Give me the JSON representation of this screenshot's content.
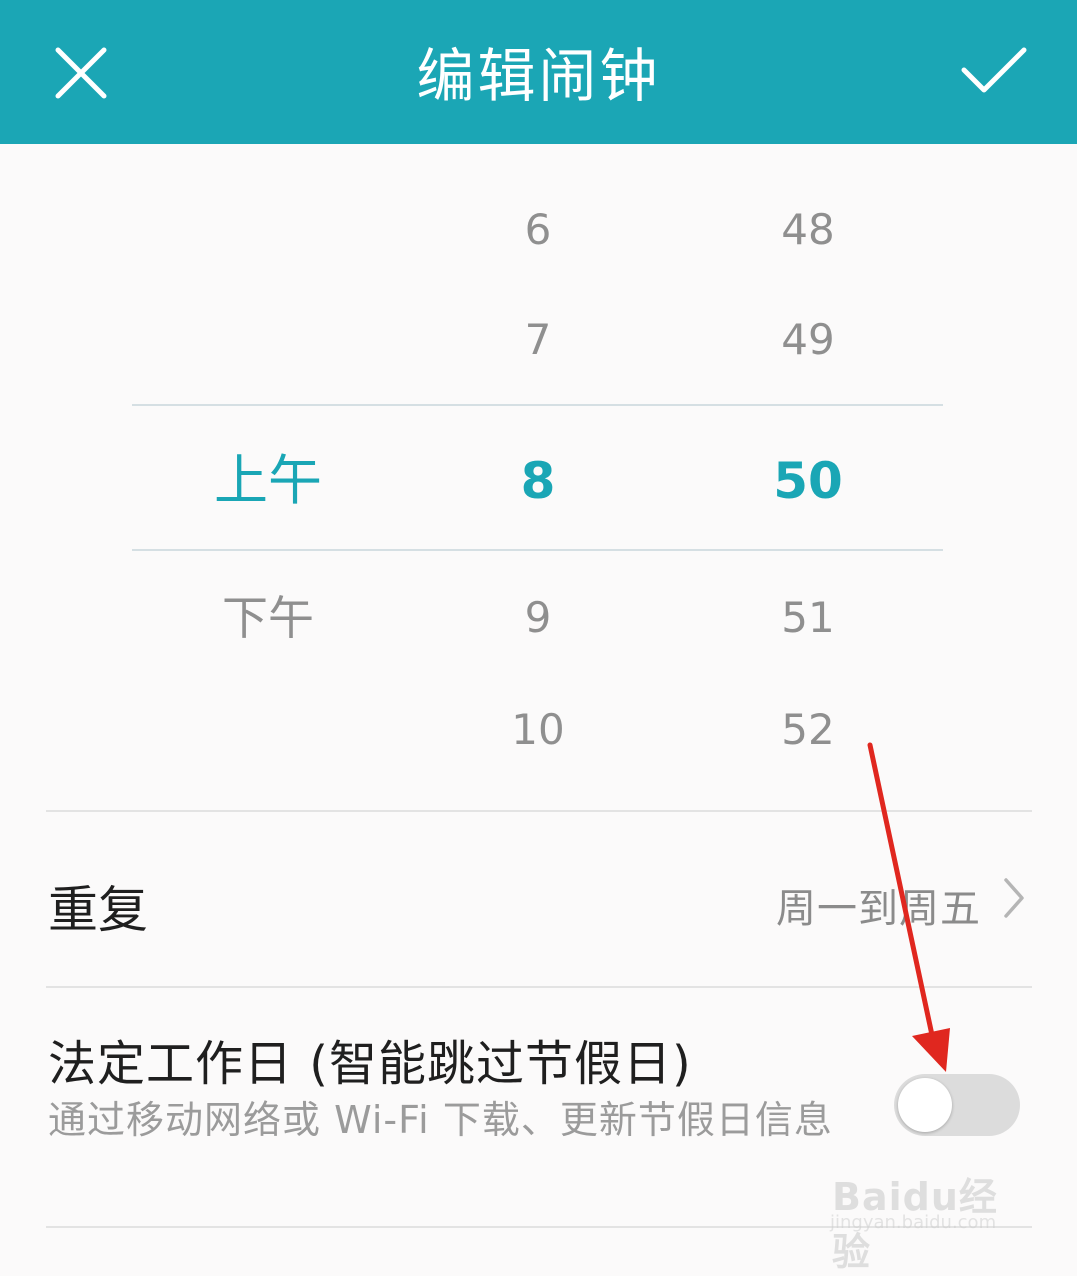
{
  "header": {
    "title": "编辑闹钟",
    "close_icon": "close-icon",
    "confirm_icon": "check-icon",
    "background_color": "#1ba6b5"
  },
  "picker": {
    "accent_color": "#1aa6b5",
    "ampm": {
      "selected": "上午",
      "below": [
        "下午"
      ]
    },
    "hour": {
      "above": [
        "6",
        "7"
      ],
      "selected": "8",
      "below": [
        "9",
        "10"
      ]
    },
    "minute": {
      "above": [
        "48",
        "49"
      ],
      "selected": "50",
      "below": [
        "51",
        "52"
      ]
    }
  },
  "repeat": {
    "label": "重复",
    "value": "周一到周五",
    "chevron_icon": "chevron-right-icon"
  },
  "holiday": {
    "title": "法定工作日 (智能跳过节假日)",
    "description": "通过移动网络或 Wi-Fi 下载、更新节假日信息",
    "toggle_on": false
  },
  "annotation": {
    "arrow_color": "#e0271f"
  },
  "watermark": {
    "brand": "Baidu经验",
    "url": "jingyan.baidu.com"
  }
}
